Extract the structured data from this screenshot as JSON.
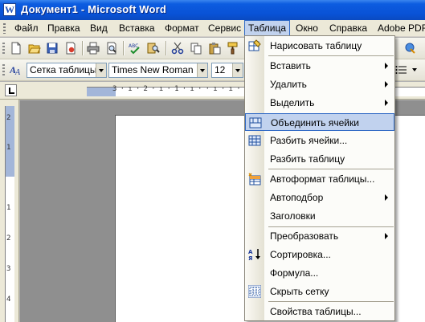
{
  "window": {
    "title": "Документ1 - Microsoft Word",
    "app_icon_letter": "W"
  },
  "menubar": {
    "items": [
      {
        "label": "Файл",
        "active": false
      },
      {
        "label": "Правка",
        "active": false
      },
      {
        "label": "Вид",
        "active": false
      },
      {
        "label": "Вставка",
        "active": false
      },
      {
        "label": "Формат",
        "active": false
      },
      {
        "label": "Сервис",
        "active": false
      },
      {
        "label": "Таблица",
        "active": true
      },
      {
        "label": "Окно",
        "active": false
      },
      {
        "label": "Справка",
        "active": false
      },
      {
        "label": "Adobe PDF",
        "active": false
      }
    ]
  },
  "format_toolbar": {
    "style": "Сетка таблицы",
    "font": "Times New Roman",
    "size": "12"
  },
  "ruler": {
    "horizontal_text": "3 · ı · 2 · ı · 1 · ı ·    · ı · ı · ı · 1",
    "vertical_numbers": [
      "2",
      "1",
      "1",
      "2",
      "3",
      "4"
    ]
  },
  "table_menu": {
    "items": [
      {
        "label": "Нарисовать таблицу",
        "icon": "draw-table-icon",
        "submenu": false,
        "hover": false
      },
      {
        "label": "Вставить",
        "icon": "",
        "submenu": true,
        "hover": false
      },
      {
        "label": "Удалить",
        "icon": "",
        "submenu": true,
        "hover": false
      },
      {
        "label": "Выделить",
        "icon": "",
        "submenu": true,
        "hover": false
      },
      {
        "label": "Объединить ячейки",
        "icon": "merge-cells-icon",
        "submenu": false,
        "hover": true
      },
      {
        "label": "Разбить ячейки...",
        "icon": "split-cells-icon",
        "submenu": false,
        "hover": false
      },
      {
        "label": "Разбить таблицу",
        "icon": "",
        "submenu": false,
        "hover": false
      },
      {
        "label": "Автоформат таблицы...",
        "icon": "autoformat-icon",
        "submenu": false,
        "hover": false
      },
      {
        "label": "Автоподбор",
        "icon": "",
        "submenu": true,
        "hover": false
      },
      {
        "label": "Заголовки",
        "icon": "",
        "submenu": false,
        "hover": false
      },
      {
        "label": "Преобразовать",
        "icon": "",
        "submenu": true,
        "hover": false
      },
      {
        "label": "Сортировка...",
        "icon": "sort-icon",
        "submenu": false,
        "hover": false
      },
      {
        "label": "Формула...",
        "icon": "",
        "submenu": false,
        "hover": false
      },
      {
        "label": "Скрыть сетку",
        "icon": "hide-grid-icon",
        "submenu": false,
        "hover": false
      },
      {
        "label": "Свойства таблицы...",
        "icon": "",
        "submenu": false,
        "hover": false
      }
    ]
  },
  "colors": {
    "titlebar": "#0952d6",
    "menu_highlight": "#c1d2ee",
    "menu_highlight_border": "#316ac5"
  }
}
